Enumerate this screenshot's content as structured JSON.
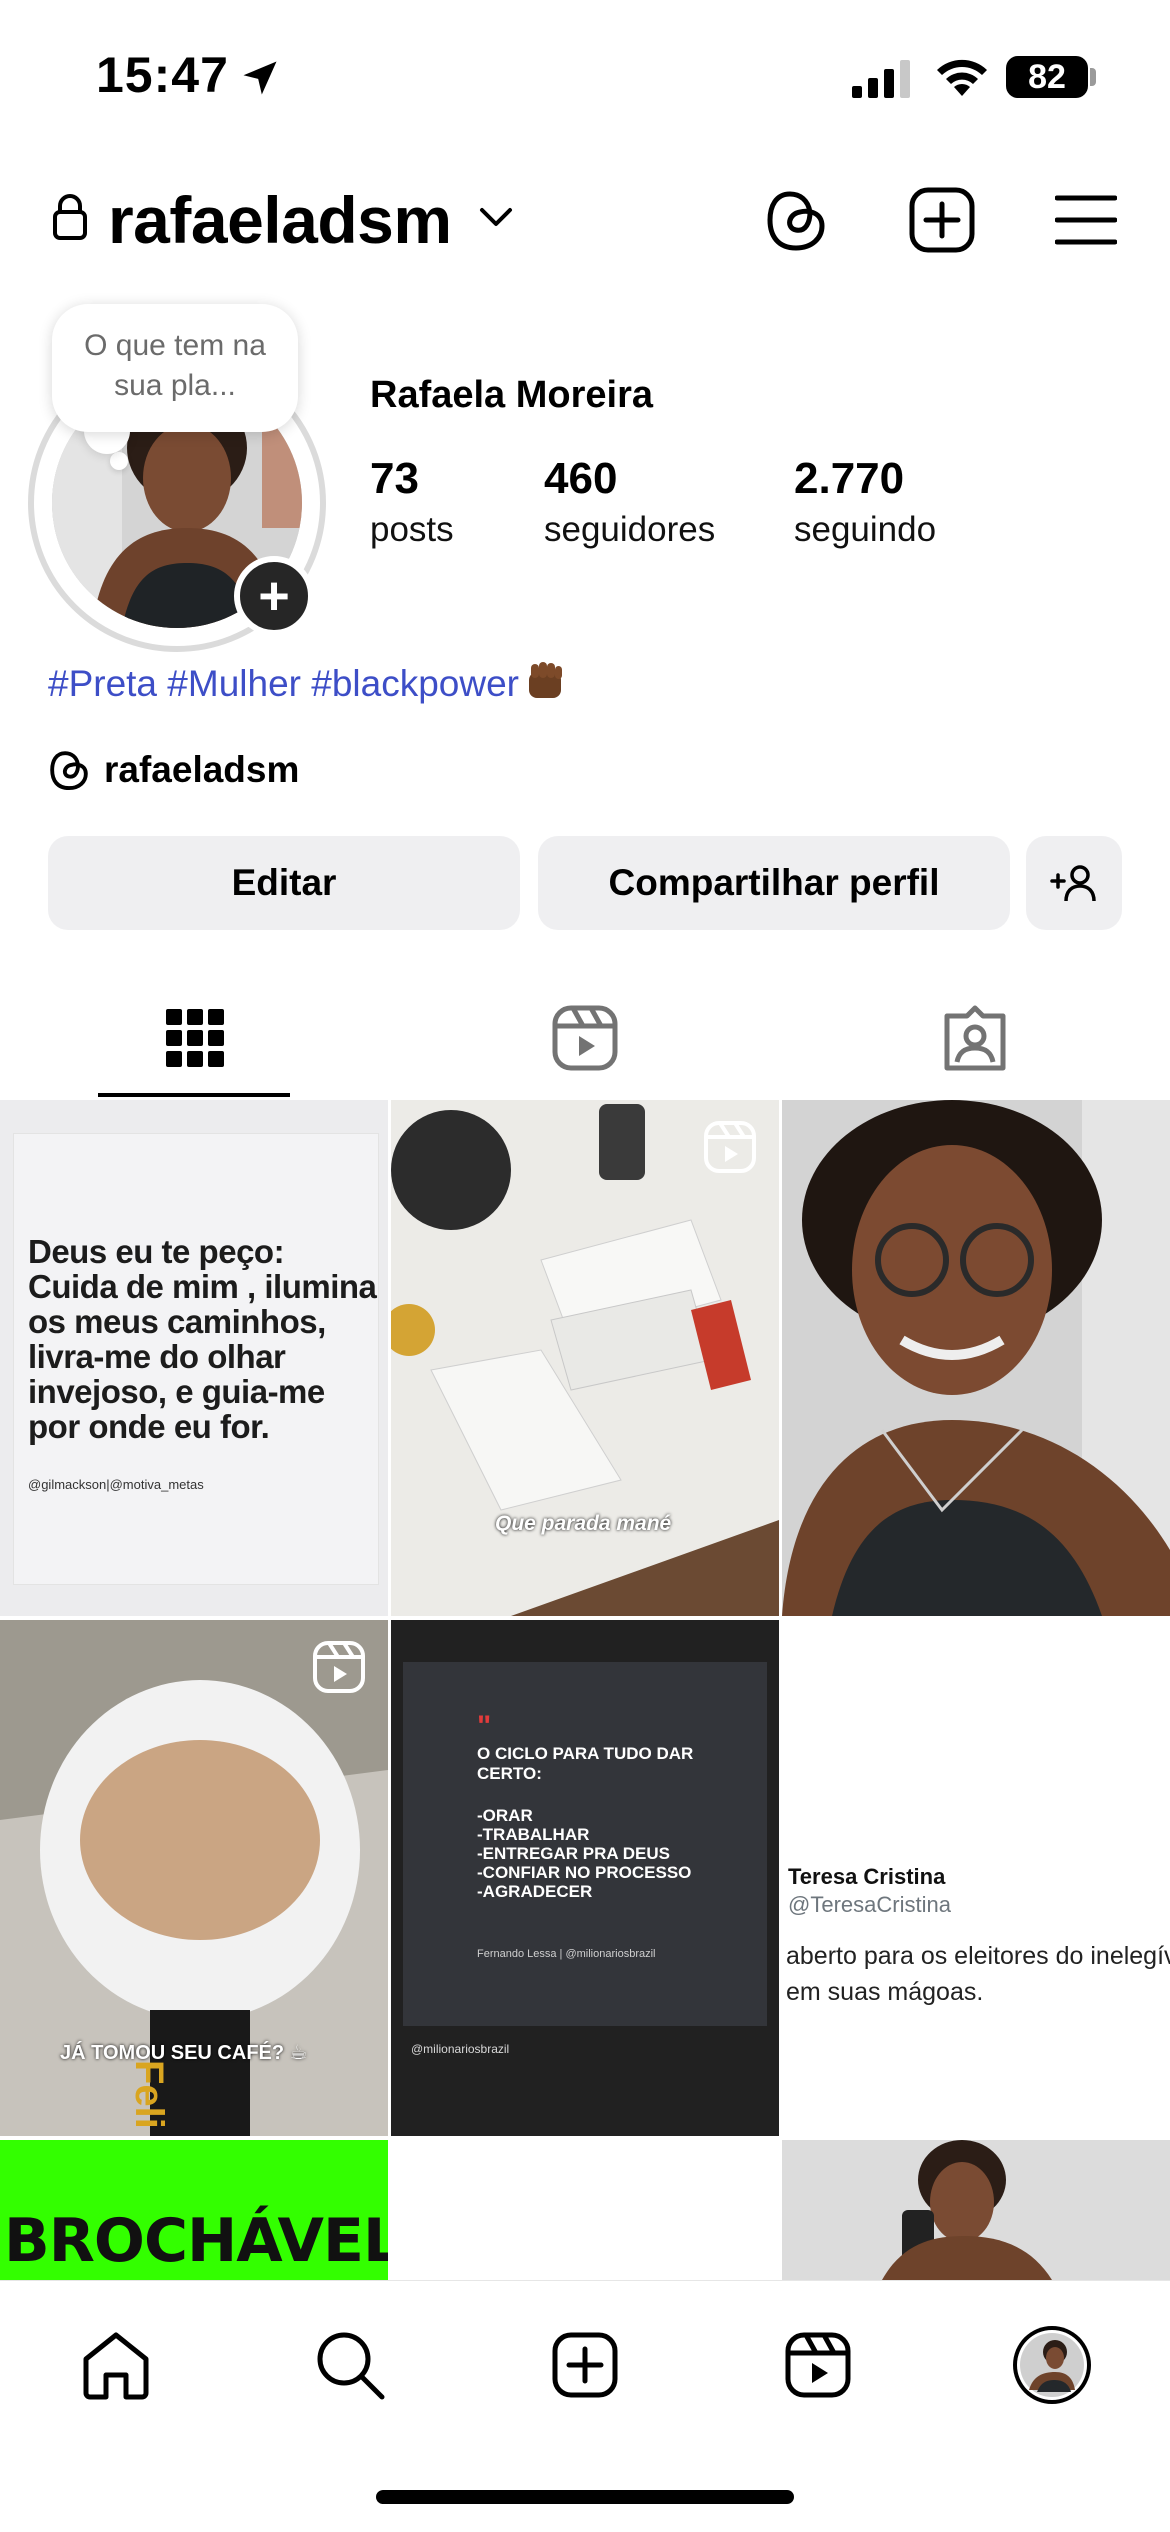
{
  "status_bar": {
    "time": "15:47",
    "battery": "82"
  },
  "header": {
    "username": "rafaeladsm"
  },
  "profile": {
    "note": "O que tem na sua pla...",
    "full_name": "Rafaela Moreira",
    "stats": [
      {
        "value": "73",
        "label": "posts"
      },
      {
        "value": "460",
        "label": "seguidores"
      },
      {
        "value": "2.770",
        "label": "seguindo"
      }
    ],
    "bio": "#Preta #Mulher  #blackpower",
    "threads_handle": "rafaeladsm"
  },
  "buttons": {
    "edit": "Editar",
    "share": "Compartilhar perfil"
  },
  "posts": {
    "p1": {
      "text": "Deus eu te peço: Cuida de mim , ilumina os meus caminhos, livra-me do olhar invejoso, e guia-me por onde eu for.",
      "credit": "@gilmackson|@motiva_metas"
    },
    "p2": {
      "caption": "Que parada mané"
    },
    "p4": {
      "caption": "JÁ TOMOU SEU CAFÉ? ☕"
    },
    "p5": {
      "quote_mark": "\"",
      "title": "O CICLO PARA TUDO DAR CERTO:",
      "lines": [
        "-ORAR",
        "-TRABALHAR",
        "-ENTREGAR PRA DEUS",
        "-CONFIAR NO PROCESSO",
        "-AGRADECER"
      ],
      "credit": "Fernando Lessa | @milionariosbrazil",
      "handle": "@milionariosbrazil"
    },
    "p6": {
      "name": "Teresa Cristina",
      "handle": "@TeresaCristina",
      "text": "aberto para os eleitores do inelegível em suas mágoas."
    },
    "p7": {
      "text": "BROCHÁVEL"
    }
  },
  "colors": {
    "link": "#3d4ec7",
    "button_bg": "#efeff1",
    "accent_green": "#33ff00"
  },
  "icons": [
    "lock-icon",
    "chevron-down-icon",
    "threads-icon",
    "create-post-icon",
    "menu-icon",
    "grid-icon",
    "reels-icon",
    "tagged-icon",
    "home-icon",
    "search-icon",
    "add-icon",
    "reels-nav-icon",
    "profile-avatar-icon"
  ]
}
